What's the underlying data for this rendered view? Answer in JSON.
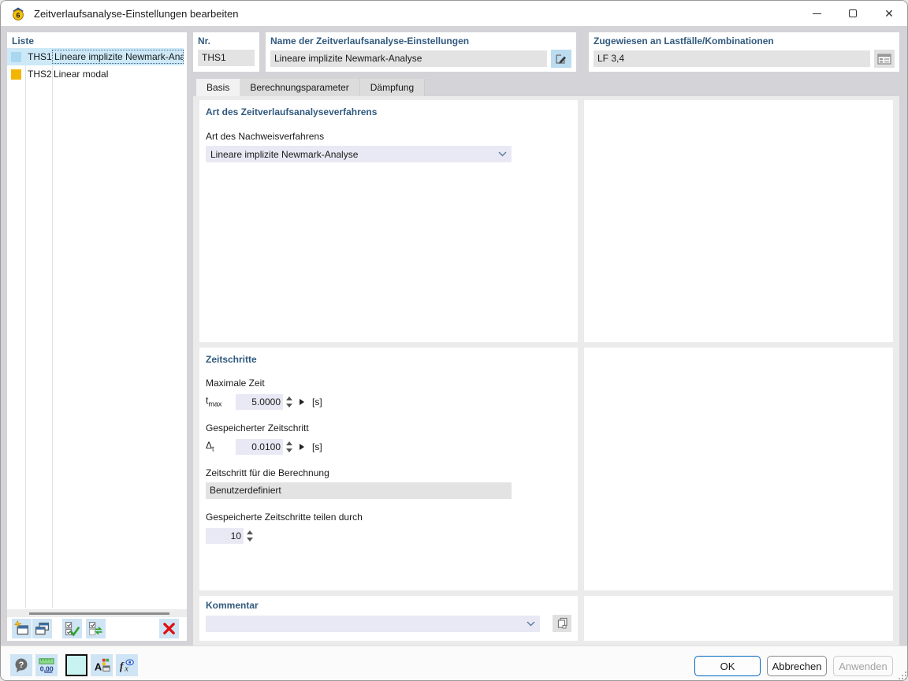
{
  "window": {
    "title": "Zeitverlaufsanalyse-Einstellungen bearbeiten"
  },
  "list_panel": {
    "title": "Liste",
    "items": [
      {
        "id": "THS1",
        "name": "Lineare implizite Newmark-Analyse",
        "swatch": "#a9d7ef"
      },
      {
        "id": "THS2",
        "name": "Linear modal",
        "swatch": "#f2b600"
      }
    ]
  },
  "header": {
    "nr": {
      "label": "Nr.",
      "value": "THS1"
    },
    "name": {
      "label": "Name der Zeitverlaufsanalyse-Einstellungen",
      "value": "Lineare implizite Newmark-Analyse"
    },
    "assigned": {
      "label": "Zugewiesen an Lastfälle/Kombinationen",
      "value": "LF 3,4"
    }
  },
  "tabs": {
    "basis": "Basis",
    "calc_params": "Berechnungsparameter",
    "damping": "Dämpfung"
  },
  "basis": {
    "method": {
      "title": "Art des Zeitverlaufsanalyseverfahrens",
      "label": "Art des Nachweisverfahrens",
      "value": "Lineare implizite Newmark-Analyse"
    },
    "steps": {
      "title": "Zeitschritte",
      "max_time": {
        "label": "Maximale Zeit",
        "sym": "t",
        "sub": "max",
        "value": "5.0000",
        "unit": "[s]"
      },
      "saved_step": {
        "label": "Gespeicherter Zeitschritt",
        "sym": "Δ",
        "sub": "t",
        "value": "0.0100",
        "unit": "[s]"
      },
      "calc_step": {
        "label": "Zeitschritt für die Berechnung",
        "value": "Benutzerdefiniert"
      },
      "divide": {
        "label": "Gespeicherte Zeitschritte teilen durch",
        "value": "10"
      }
    },
    "comment": {
      "title": "Kommentar",
      "value": ""
    }
  },
  "footer": {
    "ok": "OK",
    "cancel": "Abbrechen",
    "apply": "Anwenden"
  },
  "colors": {
    "accent": "#0067c0",
    "header_blue": "#315a7f",
    "selected_row": "#cde9f7"
  }
}
